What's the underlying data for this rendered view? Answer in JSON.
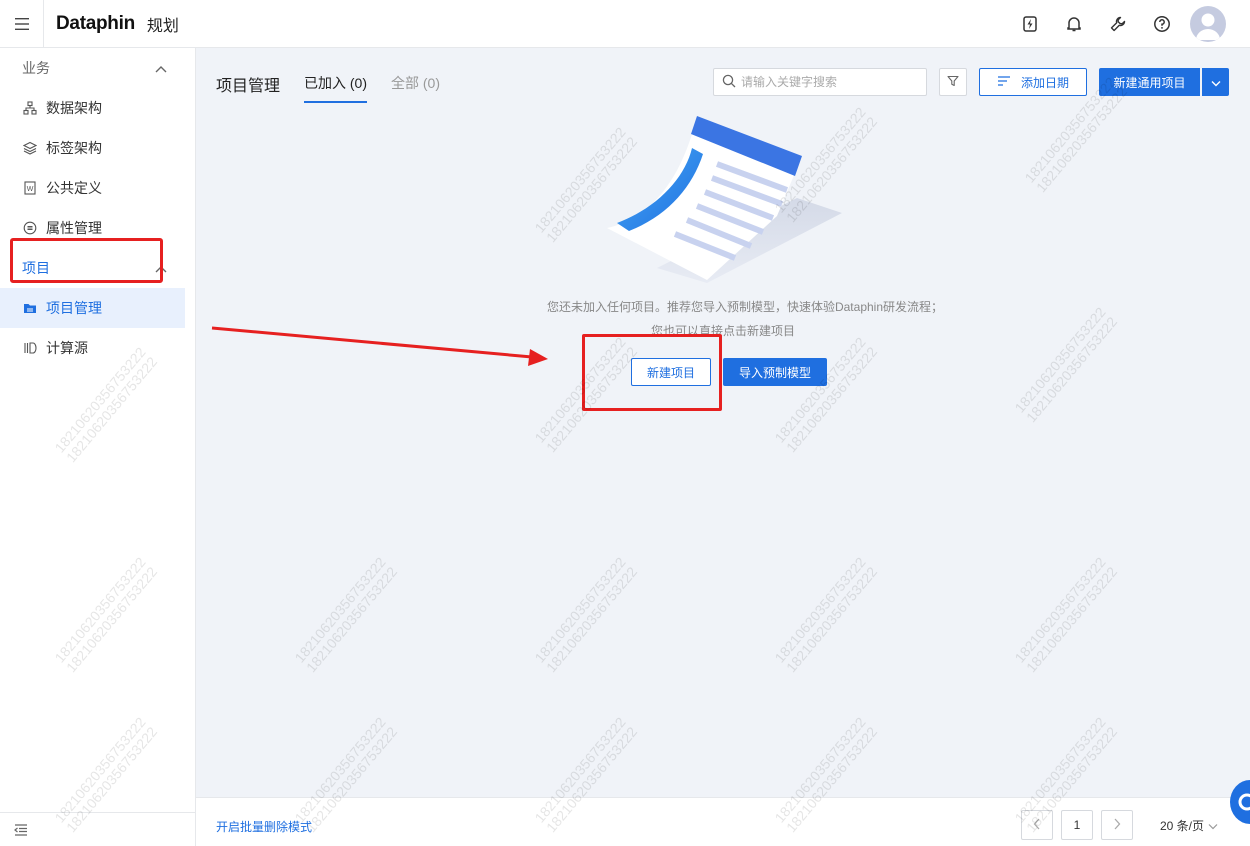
{
  "topbar": {
    "logo": "Dataphin",
    "module": "规划"
  },
  "sidebar": {
    "groups": [
      {
        "title": "业务",
        "items": [
          {
            "label": "数据架构",
            "icon": "data-architecture-icon"
          },
          {
            "label": "标签架构",
            "icon": "layers-icon"
          },
          {
            "label": "公共定义",
            "icon": "document-w-icon"
          },
          {
            "label": "属性管理",
            "icon": "attribute-icon"
          }
        ]
      },
      {
        "title": "项目",
        "items": [
          {
            "label": "项目管理",
            "icon": "folder-icon",
            "active": true
          },
          {
            "label": "计算源",
            "icon": "compute-source-icon"
          }
        ]
      }
    ]
  },
  "main": {
    "title": "项目管理",
    "tabs": [
      {
        "label": "已加入 (0)",
        "active": true
      },
      {
        "label": "全部 (0)",
        "active": false
      }
    ],
    "search_placeholder": "请输入关键字搜索",
    "add_date_label": "添加日期",
    "new_project_label": "新建通用项目"
  },
  "empty_state": {
    "line1": "您还未加入任何项目。推荐您导入预制模型，快速体验Dataphin研发流程；",
    "line2": "您也可以直接点击新建项目",
    "new_button": "新建项目",
    "import_button": "导入预制模型"
  },
  "footer": {
    "batch_delete": "开启批量删除模式",
    "current_page": "1",
    "page_size": "20 条/页"
  },
  "watermark": "18210620356753222",
  "colors": {
    "accent": "#1f6fe0",
    "highlight_red": "#e62020",
    "background": "#f0f3f8"
  }
}
